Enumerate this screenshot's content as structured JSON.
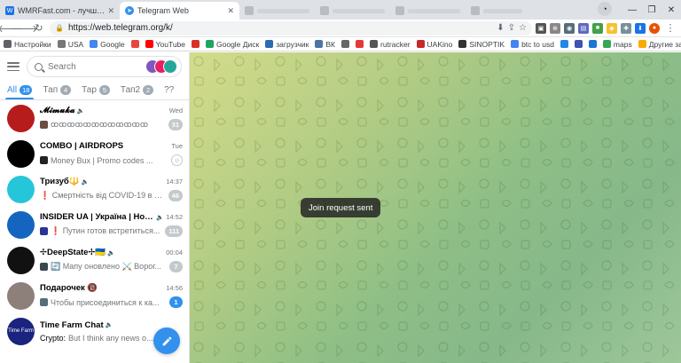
{
  "browser": {
    "tabs": [
      {
        "title": "WMRFast.com - лучшее место дл...",
        "active": false,
        "color": "#1a73e8",
        "icon": "wmr-icon"
      },
      {
        "title": "Telegram Web",
        "active": true,
        "color": "#3390ec",
        "icon": "telegram-icon"
      }
    ],
    "address": "https://web.telegram.org/k/",
    "bookmarks": [
      {
        "label": "Настройки",
        "color": "#5f6368"
      },
      {
        "label": "USA",
        "color": "#777"
      },
      {
        "label": "Google",
        "color": "#4285f4"
      },
      {
        "label": "",
        "color": "#e8453c"
      },
      {
        "label": "YouTube",
        "color": "#ff0000"
      },
      {
        "label": "",
        "color": "#d93025"
      },
      {
        "label": "Google Диск",
        "color": "#1fa463"
      },
      {
        "label": "загрузчик",
        "color": "#2b6cb0"
      },
      {
        "label": "ВК",
        "color": "#4c75a3"
      },
      {
        "label": "",
        "color": "#666"
      },
      {
        "label": "",
        "color": "#e53935"
      },
      {
        "label": "rutracker",
        "color": "#555"
      },
      {
        "label": "UAKino",
        "color": "#c62828"
      },
      {
        "label": "SINOPTIK",
        "color": "#333"
      },
      {
        "label": "btc to usd",
        "color": "#4285f4"
      },
      {
        "label": "",
        "color": "#1e88e5"
      },
      {
        "label": "",
        "color": "#3f51b5"
      },
      {
        "label": "",
        "color": "#1976d2"
      },
      {
        "label": "maps",
        "color": "#34a853"
      },
      {
        "label": "Другие закладки",
        "color": "#f9ab00"
      }
    ]
  },
  "sidebar": {
    "search_placeholder": "Search",
    "folders": [
      {
        "label": "All",
        "count": "18",
        "active": true
      },
      {
        "label": "Тап",
        "count": "4",
        "active": false
      },
      {
        "label": "Тар",
        "count": "5",
        "active": false
      },
      {
        "label": "Тап2",
        "count": "2",
        "active": false
      },
      {
        "label": "??",
        "count": "",
        "active": false
      }
    ],
    "chats": [
      {
        "name": "𝓜𝓲𝓶𝓾𝓴𝓪",
        "time": "Wed",
        "preview": "ꝏꝏꝏꝏꝏꝏꝏꝏꝏꝏꝏꝏ",
        "sender": "",
        "badge": "31",
        "badge_style": "gray",
        "avatar_color": "#b71c1c",
        "avatar_text": "",
        "thumb_color": "#6d4c41",
        "muted": true
      },
      {
        "name": "COMBO | AIRDROPS",
        "time": "Tue",
        "preview": "Money Bux | Promo codes ...",
        "sender": "",
        "badge": "",
        "badge_style": "pin",
        "avatar_color": "#000000",
        "avatar_text": "",
        "thumb_color": "#222",
        "muted": false
      },
      {
        "name": "Тризуб🔱",
        "time": "14:37",
        "preview": "❗ Смертність від COVID-19 в У...",
        "sender": "",
        "badge": "46",
        "badge_style": "gray",
        "avatar_color": "#26c6da",
        "avatar_text": "",
        "thumb_color": "",
        "muted": true
      },
      {
        "name": "INSIDER UA | Україна | Новини",
        "time": "14:52",
        "preview": "❗ Путин готов встретиться...",
        "sender": "",
        "badge": "111",
        "badge_style": "gray",
        "avatar_color": "#1565c0",
        "avatar_text": "",
        "thumb_color": "#283593",
        "muted": true
      },
      {
        "name": "✢DeepState✢🇺🇦",
        "time": "00:04",
        "preview": "🔄 Мапу оновлено ⚔️ Ворог...",
        "sender": "",
        "badge": "7",
        "badge_style": "gray",
        "avatar_color": "#111111",
        "avatar_text": "",
        "thumb_color": "#37474f",
        "muted": true
      },
      {
        "name": "Подарочек 🔞",
        "time": "14:56",
        "preview": "Чтобы присоединиться к ка...",
        "sender": "",
        "badge": "1",
        "badge_style": "blue",
        "avatar_color": "#8d7f7a",
        "avatar_text": "",
        "thumb_color": "#546e7a",
        "muted": false
      },
      {
        "name": "Time Farm Chat",
        "time": "",
        "preview": "But I think any news o...",
        "sender": "Crypto:",
        "badge": "",
        "badge_style": "none",
        "avatar_color": "#1a237e",
        "avatar_text": "Time Farm",
        "thumb_color": "",
        "muted": true
      }
    ]
  },
  "main": {
    "toast": "Join request sent",
    "bg_colors": [
      "#d4dc8a",
      "#8fbf86"
    ]
  }
}
